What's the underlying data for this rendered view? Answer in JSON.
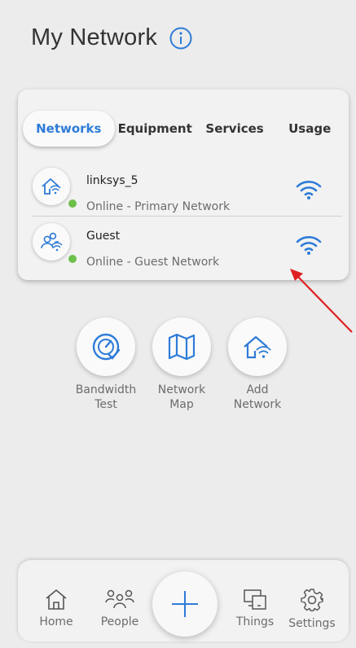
{
  "header": {
    "title": "My Network",
    "info_icon": "info-icon"
  },
  "colors": {
    "accent": "#2e7bd8",
    "online": "#6cc04a",
    "annotation": "#e02020"
  },
  "tabs": [
    {
      "label": "Networks",
      "active": true
    },
    {
      "label": "Equipment",
      "active": false
    },
    {
      "label": "Services",
      "active": false
    },
    {
      "label": "Usage",
      "active": false
    }
  ],
  "networks": [
    {
      "name": "linksys_5",
      "status": "Online - Primary Network",
      "icon": "home-wifi-icon",
      "signal_icon": "wifi-icon"
    },
    {
      "name": "Guest",
      "status": "Online - Guest Network",
      "icon": "guest-users-icon",
      "signal_icon": "wifi-icon"
    }
  ],
  "actions": [
    {
      "label_line1": "Bandwidth",
      "label_line2": "Test",
      "icon": "speedometer-icon"
    },
    {
      "label_line1": "Network",
      "label_line2": "Map",
      "icon": "map-icon"
    },
    {
      "label_line1": "Add",
      "label_line2": "Network",
      "icon": "home-wifi-icon"
    }
  ],
  "bottom_nav": [
    {
      "label": "Home",
      "icon": "home-icon"
    },
    {
      "label": "People",
      "icon": "people-icon"
    },
    {
      "label": "",
      "icon": "plus-icon"
    },
    {
      "label": "Things",
      "icon": "devices-icon"
    },
    {
      "label": "Settings",
      "icon": "gear-icon"
    }
  ]
}
